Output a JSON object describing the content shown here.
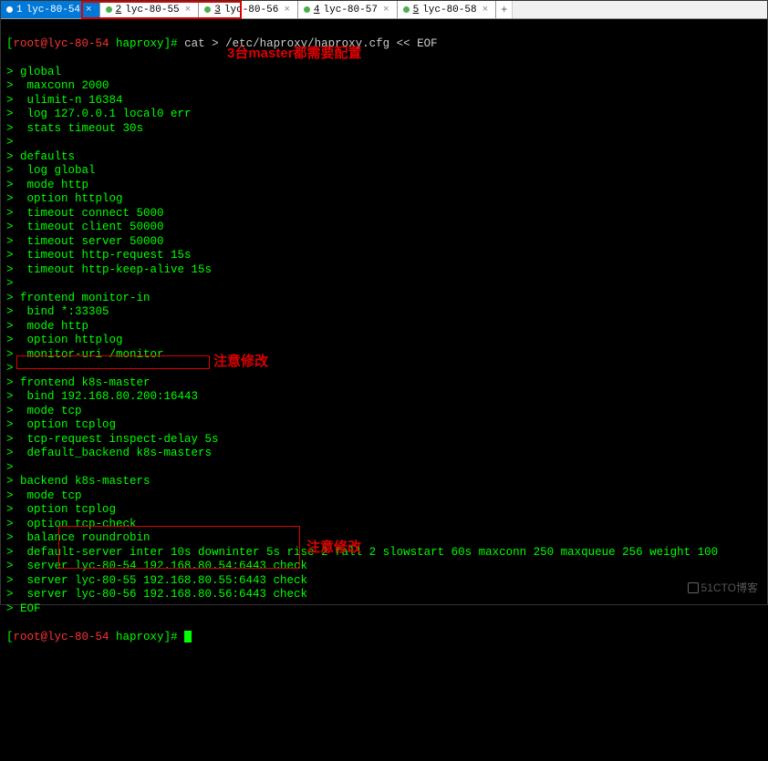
{
  "tabs": [
    {
      "num": "1",
      "label": "lyc-80-54",
      "active": true
    },
    {
      "num": "2",
      "label": "lyc-80-55",
      "active": false
    },
    {
      "num": "3",
      "label": "lyc-80-56",
      "active": false
    },
    {
      "num": "4",
      "label": "lyc-80-57",
      "active": false
    },
    {
      "num": "5",
      "label": "lyc-80-58",
      "active": false
    }
  ],
  "prompt": {
    "open": "[",
    "user_host": "root@lyc-80-54",
    "path": " haproxy",
    "close": "]# "
  },
  "cmd": "cat > /etc/haproxy/haproxy.cfg << EOF",
  "lines": [
    "> global",
    ">  maxconn 2000",
    ">  ulimit-n 16384",
    ">  log 127.0.0.1 local0 err",
    ">  stats timeout 30s",
    ">",
    "> defaults",
    ">  log global",
    ">  mode http",
    ">  option httplog",
    ">  timeout connect 5000",
    ">  timeout client 50000",
    ">  timeout server 50000",
    ">  timeout http-request 15s",
    ">  timeout http-keep-alive 15s",
    ">",
    "> frontend monitor-in",
    ">  bind *:33305",
    ">  mode http",
    ">  option httplog",
    ">  monitor-uri /monitor",
    ">",
    "> frontend k8s-master",
    ">  bind 192.168.80.200:16443",
    ">  mode tcp",
    ">  option tcplog",
    ">  tcp-request inspect-delay 5s",
    ">  default_backend k8s-masters",
    ">",
    "> backend k8s-masters",
    ">  mode tcp",
    ">  option tcplog",
    ">  option tcp-check",
    ">  balance roundrobin",
    ">  default-server inter 10s downinter 5s rise 2 fall 2 slowstart 60s maxconn 250 maxqueue 256 weight 100",
    ">  server lyc-80-54 192.168.80.54:6443 check",
    ">  server lyc-80-55 192.168.80.55:6443 check",
    ">  server lyc-80-56 192.168.80.56:6443 check",
    "> EOF"
  ],
  "annotations": {
    "top": "3台master都需要配置",
    "mid": "注意修改",
    "bottom": "注意修改"
  },
  "watermark": "51CTO博客"
}
